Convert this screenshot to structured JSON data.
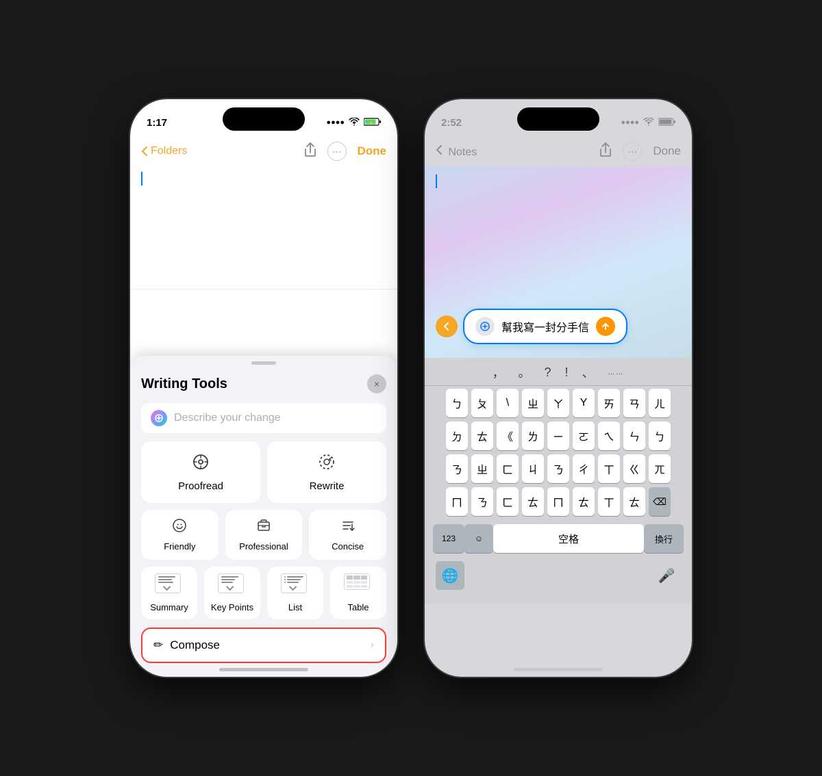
{
  "phone1": {
    "status": {
      "time": "1:17",
      "signal": "....",
      "wifi": "WiFi",
      "battery": "⚡"
    },
    "nav": {
      "back_label": "Folders",
      "done_label": "Done"
    },
    "writing_tools": {
      "title": "Writing Tools",
      "search_placeholder": "Describe your change",
      "close_icon": "×",
      "buttons": {
        "proofread": "Proofread",
        "rewrite": "Rewrite",
        "friendly": "Friendly",
        "professional": "Professional",
        "concise": "Concise",
        "summary": "Summary",
        "key_points": "Key Points",
        "list": "List",
        "table": "Table"
      },
      "compose": {
        "label": "Compose",
        "icon": "✏"
      }
    }
  },
  "phone2": {
    "status": {
      "time": "2:52",
      "signal": "....",
      "wifi": "WiFi",
      "battery": "■"
    },
    "nav": {
      "back_label": "Notes",
      "done_label": "Done"
    },
    "input": {
      "text": "幫我寫一封分手信"
    },
    "keyboard": {
      "punct_row": [
        ",",
        "。",
        "?",
        "!",
        "、",
        "……"
      ],
      "row1": [
        "ㄅ",
        "ㄆ",
        "\\",
        "ㄓ",
        "ㄚ",
        "Y",
        "ㄞ",
        "ㄢ",
        "ㄦ"
      ],
      "row2": [
        "ㄉ",
        "ㄊ",
        "《",
        "ㄌ",
        "ㄧ",
        "ㄛ",
        "ㄟ",
        "ㄣ",
        "ㄅ"
      ],
      "row3": [
        "ㄋ",
        "ㄓ",
        "ㄈ",
        "ㄐ",
        "ㄋ",
        "ㄔ",
        "ㄒ",
        "ㄍ",
        "ㄫ"
      ],
      "row4": [
        "ㄇ",
        "ㄋ",
        "ㄈ",
        "ㄊ",
        "ㄇ",
        "ㄊ",
        "ㄒ",
        "ㄊ",
        "⌫"
      ],
      "bottom": {
        "num": "123",
        "emoji": "☺",
        "space": "空格",
        "enter": "換行"
      }
    }
  }
}
